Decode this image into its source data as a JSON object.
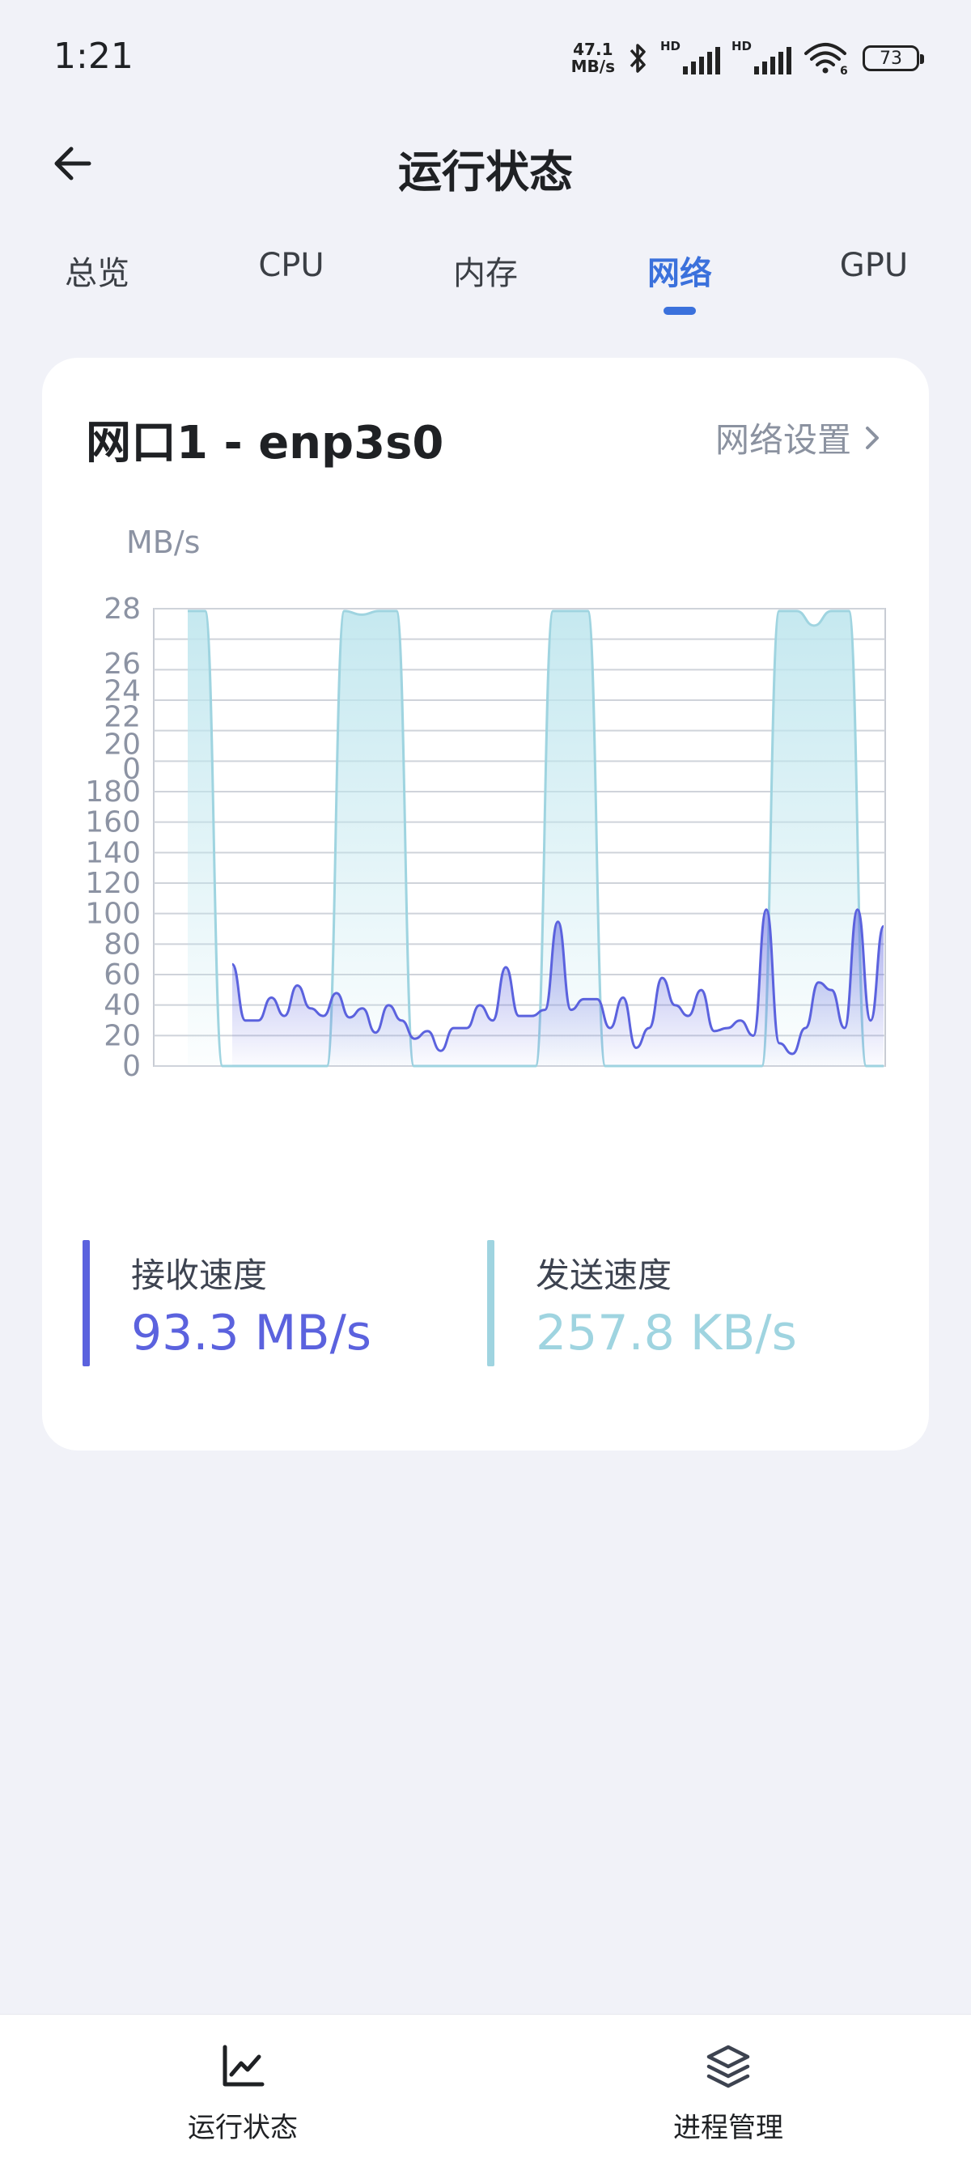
{
  "status_bar": {
    "time": "1:21",
    "net_speed_value": "47.1",
    "net_speed_unit": "MB/s",
    "signal_1_tag": "HD",
    "signal_2_tag": "HD",
    "wifi_tag": "6",
    "battery": "73"
  },
  "header": {
    "title": "运行状态",
    "back_icon": "arrow-left-icon"
  },
  "tabs": [
    {
      "label": "总览",
      "active": false
    },
    {
      "label": "CPU",
      "active": false
    },
    {
      "label": "内存",
      "active": false
    },
    {
      "label": "网络",
      "active": true
    },
    {
      "label": "GPU",
      "active": false
    }
  ],
  "card": {
    "interface_name": "网口1 - enp3s0",
    "settings_link": "网络设置",
    "unit_label": "MB/s",
    "receive_label": "接收速度",
    "receive_value": "93.3 MB/s",
    "send_label": "发送速度",
    "send_value": "257.8 KB/s"
  },
  "colors": {
    "accent": "#3b71dc",
    "receive": "#5b62de",
    "send": "#9fd4e0",
    "muted": "#8c93a3"
  },
  "chart_data": {
    "type": "area",
    "y_tick_labels": [
      "0",
      "20",
      "40",
      "60",
      "80",
      "100",
      "120",
      "140",
      "160",
      "180",
      "0",
      "20",
      "22",
      "24",
      "26",
      "28"
    ],
    "series": [
      {
        "values": [
          67,
          30,
          30,
          45,
          33,
          53,
          38,
          33,
          48,
          32,
          38,
          22,
          40,
          30,
          18,
          23,
          10,
          25,
          25,
          40,
          30,
          65,
          33,
          33,
          37,
          95,
          37,
          44,
          44,
          25,
          45,
          12,
          25,
          58,
          40,
          33,
          50,
          23,
          25,
          30,
          20,
          103,
          15,
          8,
          25,
          55,
          50,
          25,
          103,
          30,
          92
        ]
      },
      {
        "values": [
          250,
          250,
          0,
          0,
          0,
          0,
          0,
          0,
          0,
          250,
          248,
          250,
          250,
          0,
          0,
          0,
          0,
          0,
          0,
          0,
          0,
          250,
          250,
          250,
          0,
          0,
          0,
          0,
          0,
          0,
          0,
          0,
          0,
          0,
          250,
          250,
          242,
          250,
          250,
          0,
          0
        ]
      }
    ],
    "grid": true
  },
  "bottom_nav": [
    {
      "label": "运行状态",
      "icon": "chart-line-icon"
    },
    {
      "label": "进程管理",
      "icon": "layers-icon"
    }
  ]
}
